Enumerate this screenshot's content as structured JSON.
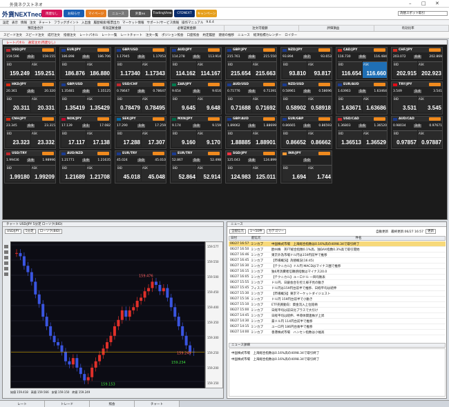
{
  "window": {
    "title": "外貨ネクストネオ"
  },
  "header": {
    "logo": "外貨NEXTneo",
    "buttons": [
      {
        "label": "両建なし",
        "color": "#d4145a"
      },
      {
        "label": "お知らせ",
        "color": "#1a5fb4"
      },
      {
        "label": "マイページ",
        "color": "#e67e22"
      },
      {
        "label": "ニュース",
        "color": "#7a7a7a"
      },
      {
        "label": "外貨ex",
        "color": "#555555"
      },
      {
        "label": "TradingView",
        "color": "#333333"
      },
      {
        "label": "CFDNEXT",
        "color": "#0a2d6e"
      },
      {
        "label": "キャンペーン",
        "color": "#e6a01e"
      }
    ],
    "spot_select": "為替スポット取引"
  },
  "menu": [
    "設定",
    "表示",
    "情報",
    "注文",
    "チャート",
    "フラッグポイント",
    "入出金",
    "履歴検索/帳票出力",
    "マーケット情報",
    "サポート/サービス情報",
    "操作マニュアル",
    "9.6.4"
  ],
  "summary": [
    "預託金合計",
    "有効証拠金額",
    "必要証拠金額",
    "注文可能額",
    "評価損益",
    "有効比率"
  ],
  "toolbar": [
    "スピード注文",
    "スピード注文",
    "成行注文",
    "指値注文",
    "レートパネル",
    "レート一覧",
    "レートチャート",
    "注文一覧",
    "ポジション照会",
    "口座照会",
    "約定履歴",
    "建値の推移",
    "ニュース",
    "経済指標カレンダー",
    "ロイター"
  ],
  "rate_panel": {
    "title": "レートパネル　通常注文(両建なし)"
  },
  "tiles": [
    {
      "pair": "USD/JPY",
      "low": "159.596",
      "high": "159.155",
      "spread": "0.2",
      "bid": "159.249",
      "ask": "159.251",
      "flag": "#c1272d"
    },
    {
      "pair": "EUR/JPY",
      "low": "186.898",
      "high": "186.706",
      "spread": "0.4",
      "bid": "186.876",
      "ask": "186.880",
      "flag": "#1a3a8f"
    },
    {
      "pair": "GBP/USD",
      "low": "1.17945",
      "high": "1.17053",
      "spread": "0.3",
      "bid": "1.17340",
      "ask": "1.17343",
      "flag": "#1a3a8f"
    },
    {
      "pair": "AUD/JPY",
      "low": "114.278",
      "high": "113.914",
      "spread": "0.5",
      "bid": "114.162",
      "ask": "114.167",
      "flag": "#1a3a8f"
    },
    {
      "pair": "GBP/JPY",
      "low": "215.761",
      "high": "215.550",
      "spread": "0.8",
      "bid": "215.654",
      "ask": "215.663",
      "flag": "#1a3a8f"
    },
    {
      "pair": "NZD/JPY",
      "low": "93.894",
      "high": "93.653",
      "spread": "0.7",
      "bid": "93.810",
      "ask": "93.817",
      "flag": "#1a3a8f"
    },
    {
      "pair": "CAD/JPY",
      "low": "116.730",
      "high": "116.484",
      "spread": "0.6",
      "bid": "116.654",
      "ask": "116.660",
      "flag": "#d52b1e",
      "highlight": true
    },
    {
      "pair": "CHF/JPY",
      "low": "203.072",
      "high": "202.869",
      "spread": "0.8",
      "bid": "202.915",
      "ask": "202.923",
      "flag": "#d52b1e"
    },
    {
      "pair": "HKD/JPY",
      "low": "20.361",
      "high": "20.320",
      "spread": "2.0",
      "bid": "20.311",
      "ask": "20.331",
      "flag": "#de2910"
    },
    {
      "pair": "GBP/USD",
      "low": "1.35481",
      "high": "1.35125",
      "spread": "0.8",
      "bid": "1.35419",
      "ask": "1.35429",
      "flag": "#1a3a8f"
    },
    {
      "pair": "USD/CHF",
      "low": "0.78647",
      "high": "0.78647",
      "spread": "0.8",
      "bid": "0.78479",
      "ask": "0.78495",
      "flag": "#c1272d"
    },
    {
      "pair": "ZAR/JPY",
      "low": "9.654",
      "high": "9.616",
      "spread": "0.3",
      "bid": "9.645",
      "ask": "9.648",
      "flag": "#007a4d"
    },
    {
      "pair": "AUD/USD",
      "low": "0.71776",
      "high": "0.71391",
      "spread": "0.4",
      "bid": "0.71688",
      "ask": "0.71692",
      "flag": "#1a3a8f"
    },
    {
      "pair": "NZD/USD",
      "low": "0.58961",
      "high": "0.58696",
      "spread": "0.8",
      "bid": "0.58902",
      "ask": "0.58918",
      "flag": "#1a3a8f"
    },
    {
      "pair": "EUR/AUD",
      "low": "1.63963",
      "high": "1.63464",
      "spread": "1.9",
      "bid": "1.63671",
      "ask": "1.63686",
      "flag": "#1a3a8f"
    },
    {
      "pair": "TRY/JPY",
      "low": "3.549",
      "high": "3.541",
      "spread": "1.4",
      "bid": "3.531",
      "ask": "3.545",
      "flag": "#e30a17"
    },
    {
      "pair": "CNH/JPY",
      "low": "23.345",
      "high": "23.315",
      "spread": "0.9",
      "bid": "23.323",
      "ask": "23.332",
      "flag": "#de2910"
    },
    {
      "pair": "NOK/JPY",
      "low": "17.139",
      "high": "17.082",
      "spread": "2.1",
      "bid": "17.117",
      "ask": "17.138",
      "flag": "#ba0c2f"
    },
    {
      "pair": "SEK/JPY",
      "low": "17.290",
      "high": "17.259",
      "spread": "1.9",
      "bid": "17.288",
      "ask": "17.307",
      "flag": "#006aa7"
    },
    {
      "pair": "MXN/JPY",
      "low": "9.174",
      "high": "9.159",
      "spread": "1.0",
      "bid": "9.160",
      "ask": "9.170",
      "flag": "#006847"
    },
    {
      "pair": "GBP/AUD",
      "low": "1.89062",
      "high": "1.88699",
      "spread": "1.6",
      "bid": "1.88885",
      "ask": "1.88901",
      "flag": "#1a3a8f"
    },
    {
      "pair": "EUR/GBP",
      "low": "0.86665",
      "high": "0.86593",
      "spread": "1.0",
      "bid": "0.86652",
      "ask": "0.86662",
      "flag": "#1a3a8f"
    },
    {
      "pair": "USD/CAD",
      "low": "1.36803",
      "high": "1.36520",
      "spread": "1.6",
      "bid": "1.36513",
      "ask": "1.36529",
      "flag": "#c1272d"
    },
    {
      "pair": "AUD/CAD",
      "low": "0.98034",
      "high": "0.97671",
      "spread": "3.0",
      "bid": "0.97857",
      "ask": "0.97887",
      "flag": "#1a3a8f"
    },
    {
      "pair": "USD/TRY",
      "low": "1.99436",
      "high": "1.98996",
      "spread": "2.9",
      "bid": "1.99180",
      "ask": "1.99209",
      "flag": "#c1272d"
    },
    {
      "pair": "AUD/NZD",
      "low": "1.21771",
      "high": "1.21635",
      "spread": "1.9",
      "bid": "1.21689",
      "ask": "1.21708",
      "flag": "#1a3a8f"
    },
    {
      "pair": "EUR/TRY",
      "low": "45.024",
      "high": "45.010",
      "spread": "3.0",
      "bid": "45.018",
      "ask": "45.048",
      "flag": "#1a3a8f"
    },
    {
      "pair": "EUR/TRY",
      "low": "52.867",
      "high": "52.498",
      "spread": "5.0",
      "bid": "52.864",
      "ask": "52.914",
      "flag": "#1a3a8f"
    },
    {
      "pair": "SGD/JPY",
      "low": "125.043",
      "high": "124.899",
      "spread": "2.8",
      "bid": "124.983",
      "ask": "125.011",
      "flag": "#ef3340"
    },
    {
      "pair": "INR/JPY",
      "low": "",
      "high": "",
      "spread": "5.0",
      "bid": "1.694",
      "ask": "1.744",
      "flag": "#ff9933"
    }
  ],
  "chart": {
    "title": "チャート USD/JPY 5分足 ローソク(BID)",
    "pair_select": "USD/JPY",
    "interval_select": "5分足",
    "type_select": "ローソク(BID)",
    "footer": "始値 159.418　高値 159.566　安値 159.150　終値 159.249",
    "price_labels": [
      "159.577",
      "159.550",
      "159.500",
      "159.450",
      "159.400",
      "159.350",
      "159.300",
      "159.250",
      "159.200",
      "159.150"
    ],
    "annotations": [
      "159.476",
      "159.249",
      "159.234",
      "159.153"
    ]
  },
  "news": {
    "title": "ニュース",
    "filter1": "全配信元",
    "filter2": "1〜50件",
    "search_label": "カテゴリー",
    "auto_update": "自動更新",
    "last_update": "最終更新:06/27 16:57",
    "refresh": "更新",
    "columns": [
      "日付",
      "配信元",
      "件名"
    ],
    "rows": [
      {
        "date": "06/27 16:57",
        "source": "ミンカブ",
        "title": "中国株式市場　上海総合指数は0.16%高の4098.34で取引終了",
        "selected": true
      },
      {
        "date": "06/27 16:50",
        "source": "ミンカブ",
        "title": "欧州株　英FT総合指数0.1%高、独DAX指数0.3%高で取引開始"
      },
      {
        "date": "06/27 16:46",
        "source": "ミンカブ",
        "title": "東京外為市場ドル円は159円前半で推移"
      },
      {
        "date": "06/27 16:45",
        "source": "ミンカブ",
        "title": "【市場概況】為替概況(16:45)"
      },
      {
        "date": "06/27 16:30",
        "source": "ミンカブ",
        "title": "【テクニカル】ドル円 MACDはマイナス圏で推移"
      },
      {
        "date": "06/27 16:15",
        "source": "ミンカブ",
        "title": "独6月消費者信頼感指数はマイナス20.0"
      },
      {
        "date": "06/27 16:05",
        "source": "ミンカブ",
        "title": "【テクニカル】ユーロドル 一目均衡表"
      },
      {
        "date": "06/27 15:55",
        "source": "ミンカブ",
        "title": "ドル円、日銀会合を控え様子見の動き"
      },
      {
        "date": "06/27 15:45",
        "source": "フィスコ",
        "title": "ドル円は159円台前半で推移、日経平均は続伸"
      },
      {
        "date": "06/27 15:30",
        "source": "ミンカブ",
        "title": "【市場概況】東京マーケットダイジェスト"
      },
      {
        "date": "06/27 15:16",
        "source": "ミンカブ",
        "title": "ドル円 159円台前半で小動き"
      },
      {
        "date": "06/27 15:10",
        "source": "ミンカブ",
        "title": "ETF売買動向：資金流入上位銘柄"
      },
      {
        "date": "06/27 15:00",
        "source": "ミンカブ",
        "title": "日経平均は前日比プラスで大引け"
      },
      {
        "date": "06/27 14:45",
        "source": "ミンカブ",
        "title": "日経平均は続伸、半導体関連株が上昇"
      },
      {
        "date": "06/27 14:30",
        "source": "ミンカブ",
        "title": "豪ドル円 114円台前半で推移"
      },
      {
        "date": "06/27 14:15",
        "source": "ミンカブ",
        "title": "ユーロ円 186円台後半で推移"
      },
      {
        "date": "06/27 14:00",
        "source": "ミンカブ",
        "title": "香港株式市場　ハンセン指数は小幅高"
      }
    ],
    "detail_title": "ニュース詳細",
    "detail_lines": [
      "中国株式市場　上海総合指数は0.16%高の4098.34で取引終了",
      "中国株式市場　上海総合指数は0.16%高の4098.34で取引終了"
    ]
  },
  "bottom_tabs": [
    "レート",
    "トレード",
    "照会",
    "チャート"
  ],
  "chart_data": {
    "type": "line",
    "ylim": [
      159.15,
      159.577
    ],
    "x": [
      "13:00",
      "13:05",
      "13:10",
      "13:15",
      "13:20",
      "13:25",
      "13:30",
      "13:35",
      "13:40",
      "13:45",
      "13:50",
      "13:55",
      "14:00",
      "14:05",
      "14:10",
      "14:15",
      "14:20",
      "14:25",
      "14:30",
      "14:35",
      "14:40",
      "14:45",
      "14:50",
      "14:55",
      "15:00",
      "15:05",
      "15:10",
      "15:15",
      "15:20",
      "15:25",
      "15:30",
      "15:35",
      "15:40",
      "15:45",
      "15:50",
      "15:55",
      "16:00",
      "16:05",
      "16:10",
      "16:15",
      "16:20",
      "16:25",
      "16:30",
      "16:35",
      "16:40",
      "16:45",
      "16:50",
      "16:55"
    ],
    "series": [
      {
        "values": [
          159.56,
          159.55,
          159.52,
          159.5,
          159.47,
          159.43,
          159.4,
          159.36,
          159.33,
          159.3,
          159.28,
          159.27,
          159.25,
          159.22,
          159.21,
          159.23,
          159.2,
          159.18,
          159.16,
          159.17,
          159.2,
          159.22,
          159.24,
          159.26,
          159.28,
          159.3,
          159.33,
          159.35,
          159.38,
          159.36,
          159.38,
          159.39,
          159.41,
          159.42,
          159.44,
          159.45,
          159.47,
          159.46,
          159.44,
          159.45,
          159.42,
          159.39,
          159.36,
          159.33,
          159.3,
          159.27,
          159.25,
          159.249
        ]
      }
    ]
  }
}
